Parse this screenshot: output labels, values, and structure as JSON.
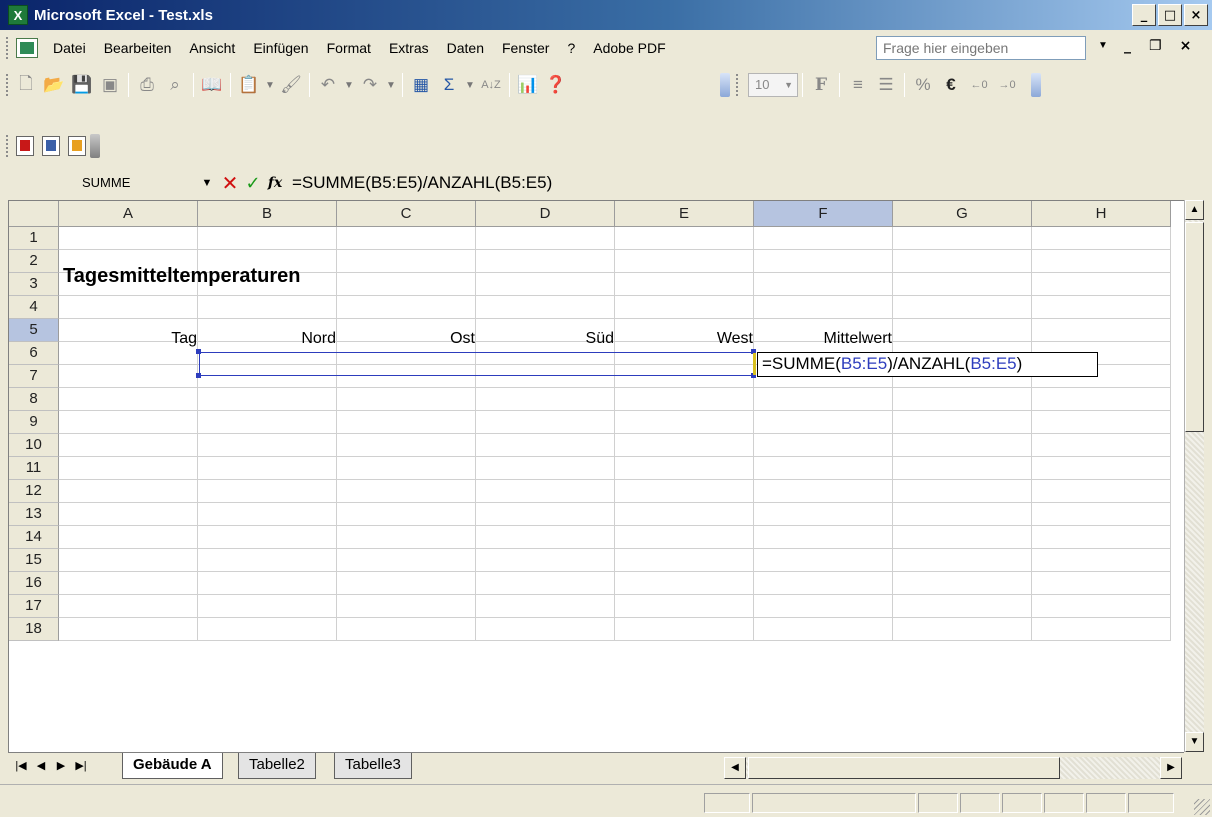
{
  "window": {
    "title": "Microsoft Excel - Test.xls",
    "app_icon": "excel-icon",
    "buttons": {
      "minimize": "_",
      "maximize": "□",
      "close": "×"
    }
  },
  "menu": {
    "items": [
      "Datei",
      "Bearbeiten",
      "Ansicht",
      "Einfügen",
      "Format",
      "Extras",
      "Daten",
      "Fenster",
      "?",
      "Adobe PDF"
    ],
    "help_placeholder": "Frage hier eingeben",
    "mdi": {
      "minimize": "_",
      "restore": "❐",
      "close": "×"
    }
  },
  "toolbar": {
    "font_size": "10",
    "bold_label": "F",
    "percent_label": "%",
    "euro_label": "€",
    "sigma_label": "Σ",
    "sort_label": "A↓Z"
  },
  "formula_bar": {
    "name_box": "SUMME",
    "fx_label": "fx",
    "formula": "=SUMME(B5:E5)/ANZAHL(B5:E5)"
  },
  "grid": {
    "columns": [
      "A",
      "B",
      "C",
      "D",
      "E",
      "F",
      "G",
      "H"
    ],
    "rows": [
      "1",
      "2",
      "3",
      "4",
      "5",
      "6",
      "7",
      "8",
      "9",
      "10",
      "11",
      "12",
      "13",
      "14",
      "15",
      "16",
      "17",
      "18"
    ],
    "selected_column": "F",
    "selected_row": "5",
    "title": "Tagesmitteltemperaturen",
    "headers": [
      "Tag",
      "Nord",
      "Ost",
      "Süd",
      "West",
      "Mittelwert"
    ],
    "editing": {
      "prefix": "=SUMME(",
      "ref1": "B5:E5",
      "middle": ")/ANZAHL(",
      "ref2": "B5:E5",
      "suffix": ")"
    }
  },
  "sheets": {
    "tabs": [
      "Gebäude A",
      "Tabelle2",
      "Tabelle3"
    ],
    "active": "Gebäude A"
  },
  "colors": {
    "range_highlight": "#2d3dbd",
    "header_selected": "#b6c4e0",
    "title_gradient_start": "#0a246a"
  }
}
